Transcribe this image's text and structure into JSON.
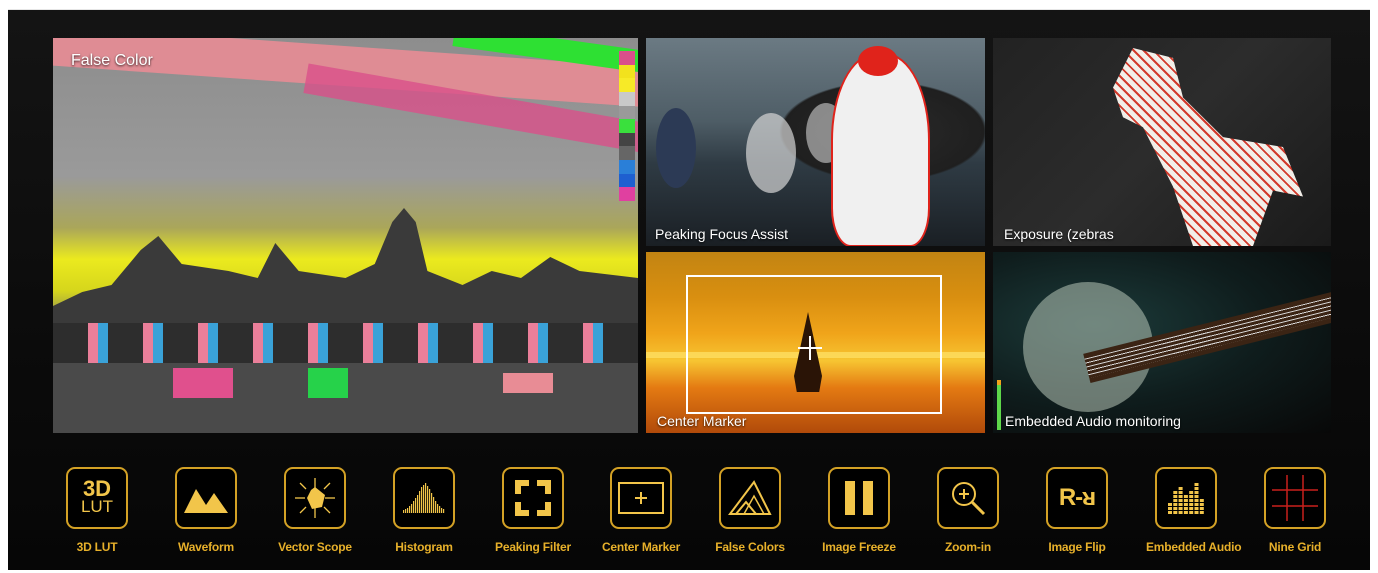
{
  "tiles": {
    "false_color": "False Color",
    "peaking": "Peaking Focus Assist",
    "exposure": "Exposure (zebras",
    "center_marker": "Center Marker",
    "audio": "Embedded Audio monitoring"
  },
  "false_color_scale": [
    "#d94f8a",
    "#f2e21d",
    "#f7ea27",
    "#c9c9c9",
    "#9a9a9a",
    "#3ae03d",
    "#444444",
    "#666666",
    "#2a7fd8",
    "#1e5fd0",
    "#e040a0"
  ],
  "accent_color": "#d3a125",
  "toolbar": [
    {
      "label": "3D LUT",
      "icon": "3d-lut-icon",
      "icon_text_top": "3D",
      "icon_text_bottom": "LUT"
    },
    {
      "label": "Waveform",
      "icon": "waveform-icon"
    },
    {
      "label": "Vector Scope",
      "icon": "vector-scope-icon"
    },
    {
      "label": "Histogram",
      "icon": "histogram-icon"
    },
    {
      "label": "Peaking Filter",
      "icon": "peaking-filter-icon"
    },
    {
      "label": "Center Marker",
      "icon": "center-marker-icon"
    },
    {
      "label": "False Colors",
      "icon": "false-colors-icon"
    },
    {
      "label": "Image Freeze",
      "icon": "pause-icon"
    },
    {
      "label": "Zoom-in",
      "icon": "zoom-in-icon"
    },
    {
      "label": "Image Flip",
      "icon": "image-flip-icon",
      "icon_text": "R-ᴚ"
    },
    {
      "label": "Embedded Audio",
      "icon": "audio-meter-icon"
    },
    {
      "label": "Nine Grid",
      "icon": "nine-grid-icon"
    }
  ]
}
